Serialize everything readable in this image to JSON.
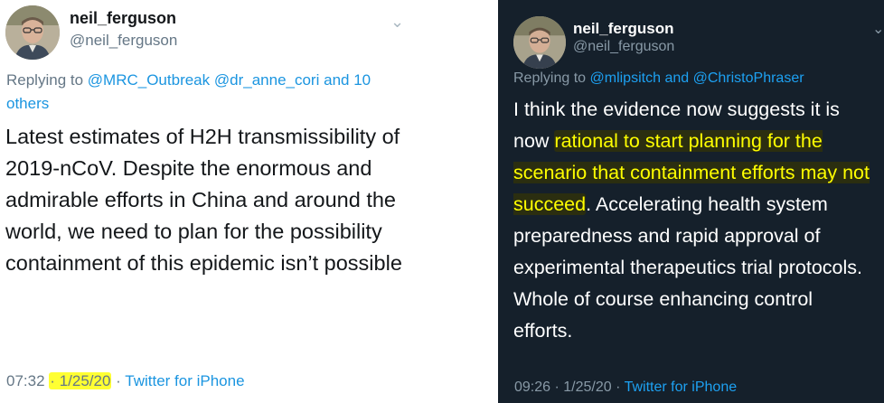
{
  "left_tweet": {
    "author_name": "neil_ferguson",
    "author_handle": "@neil_ferguson",
    "reply_prefix": "Replying to ",
    "reply_user_1": "@MRC_Outbreak",
    "reply_user_2": "@dr_anne_cori",
    "reply_and": "and",
    "reply_others": "10 others",
    "body_text": "Latest estimates of H2H transmissibility of 2019-nCoV. Despite the enormous and admirable efforts in China and around the world, we need to plan for the possibility containment of this epidemic isn’t possible",
    "time": "07:32",
    "separator": "·",
    "date": "1/25/20",
    "source": "Twitter for iPhone",
    "menu_icon": "chevron-down-icon"
  },
  "right_tweet": {
    "author_name": "neil_ferguson",
    "author_handle": "@neil_ferguson",
    "reply_prefix": "Replying to ",
    "reply_user_1": "@mlipsitch",
    "reply_and": "and",
    "reply_user_2": "@ChristoPhraser",
    "body_before": "I think the evidence now suggests it is now ",
    "body_highlight": "rational to start planning for the scenario that containment efforts may not succeed",
    "body_after": ". Accelerating health system preparedness and rapid approval of experimental therapeutics trial protocols. Whole of course enhancing control efforts.",
    "time": "09:26",
    "separator": "·",
    "date": "1/25/20",
    "source": "Twitter for iPhone",
    "menu_icon": "chevron-down-icon"
  },
  "colors": {
    "light_bg": "#ffffff",
    "dark_bg": "#15202b",
    "link_blue": "#1b95e0",
    "highlight_yellow": "#ffff33"
  }
}
